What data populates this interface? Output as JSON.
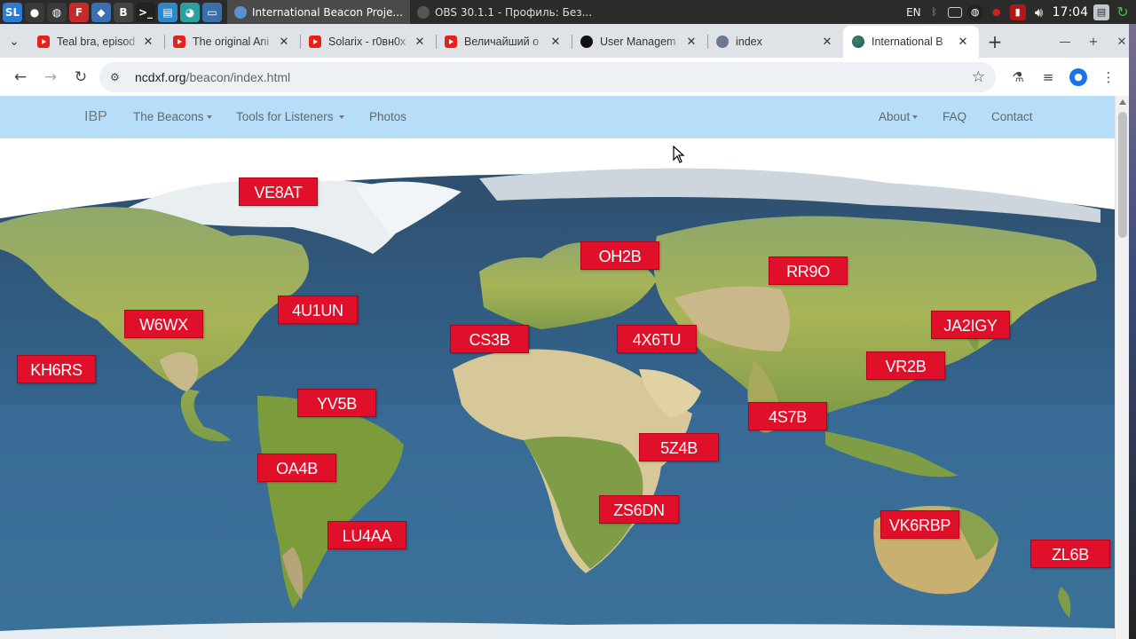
{
  "taskbar": {
    "launchers": [
      {
        "icon": "sl-app-icon",
        "glyph": "SL",
        "color": "#2d7bd0"
      },
      {
        "icon": "obs-icon",
        "glyph": "●",
        "color": "#3a3a3a"
      },
      {
        "icon": "obs-icon-2",
        "glyph": "◍",
        "color": "#3a3a3a"
      },
      {
        "icon": "filezilla-icon",
        "glyph": "F",
        "color": "#c52a2a"
      },
      {
        "icon": "git-icon",
        "glyph": "◆",
        "color": "#3a6fb0"
      },
      {
        "icon": "app-b-icon",
        "glyph": "B",
        "color": "#444"
      },
      {
        "icon": "terminal-icon",
        "glyph": ">_",
        "color": "#222"
      },
      {
        "icon": "document-icon",
        "glyph": "▤",
        "color": "#2f86c8"
      },
      {
        "icon": "network-icon",
        "glyph": "◕",
        "color": "#2aa0a0"
      },
      {
        "icon": "desktop-icon",
        "glyph": "▭",
        "color": "#3a6fa8"
      }
    ],
    "tasks": [
      {
        "label": "International Beacon Proje...",
        "active": true,
        "dot": "#5a8fd0"
      },
      {
        "label": "OBS 30.1.1 - Профиль: Без...",
        "active": false,
        "dot": "#555"
      }
    ],
    "tray": {
      "lang": "EN",
      "clock": "17:04"
    }
  },
  "browser": {
    "tabs": [
      {
        "title": "Teal bra, episod",
        "favicon": "youtube",
        "active": false
      },
      {
        "title": "The original Ani",
        "favicon": "youtube",
        "active": false
      },
      {
        "title": "Solarix - r0вн0х",
        "favicon": "youtube",
        "active": false
      },
      {
        "title": "Величайший о",
        "favicon": "youtube",
        "active": false
      },
      {
        "title": "User Managem",
        "favicon": "github",
        "active": false
      },
      {
        "title": "index",
        "favicon": "globe",
        "active": false
      },
      {
        "title": "International B",
        "favicon": "ncdxf",
        "active": true
      }
    ],
    "url_host": "ncdxf.org",
    "url_path": "/beacon/index.html"
  },
  "site_nav": {
    "brand": "IBP",
    "beacons": "The Beacons",
    "tools": "Tools for Listeners",
    "photos": "Photos",
    "about": "About",
    "faq": "FAQ",
    "contact": "Contact"
  },
  "beacons": [
    "VE8AT",
    "OH2B",
    "RR9O",
    "4U1UN",
    "W6WX",
    "JA2IGY",
    "CS3B",
    "4X6TU",
    "KH6RS",
    "VR2B",
    "YV5B",
    "4S7B",
    "5Z4B",
    "OA4B",
    "ZS6DN",
    "LU4AA",
    "VK6RBP",
    "ZL6B"
  ],
  "colors": {
    "beacon_red": "#e0102a",
    "navbar_bg": "#b6def9"
  }
}
